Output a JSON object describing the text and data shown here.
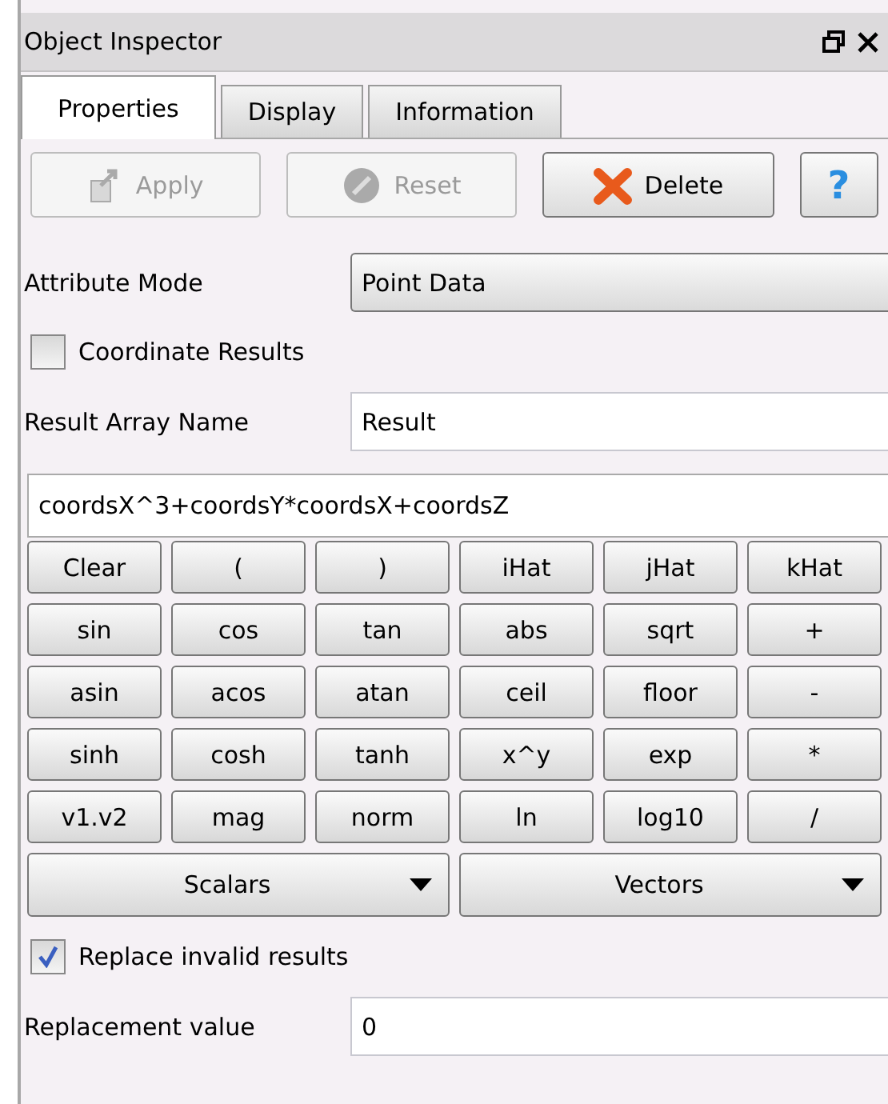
{
  "window": {
    "title": "Object Inspector"
  },
  "tabs": [
    {
      "label": "Properties",
      "selected": true
    },
    {
      "label": "Display",
      "selected": false
    },
    {
      "label": "Information",
      "selected": false
    }
  ],
  "toolbar": [
    {
      "kind": "apply",
      "label": "Apply",
      "disabled": true
    },
    {
      "kind": "reset",
      "label": "Reset",
      "disabled": true
    },
    {
      "kind": "delete",
      "label": "Delete",
      "disabled": false
    },
    {
      "kind": "help",
      "label": "?",
      "disabled": false
    }
  ],
  "attribute_mode": {
    "label": "Attribute Mode",
    "value": "Point Data"
  },
  "coordinate_results": {
    "label": "Coordinate Results",
    "checked": false
  },
  "result_array_name": {
    "label": "Result Array Name",
    "value": "Result"
  },
  "expression": "coordsX^3+coordsY*coordsX+coordsZ",
  "calculator_keys": [
    [
      "Clear",
      "(",
      ")",
      "iHat",
      "jHat",
      "kHat"
    ],
    [
      "sin",
      "cos",
      "tan",
      "abs",
      "sqrt",
      "+"
    ],
    [
      "asin",
      "acos",
      "atan",
      "ceil",
      "floor",
      "-"
    ],
    [
      "sinh",
      "cosh",
      "tanh",
      "x^y",
      "exp",
      "*"
    ],
    [
      "v1.v2",
      "mag",
      "norm",
      "ln",
      "log10",
      "/"
    ]
  ],
  "menus": [
    "Scalars",
    "Vectors"
  ],
  "replace_invalid": {
    "label": "Replace invalid results",
    "checked": true
  },
  "replacement_value": {
    "label": "Replacement value",
    "value": "0"
  }
}
